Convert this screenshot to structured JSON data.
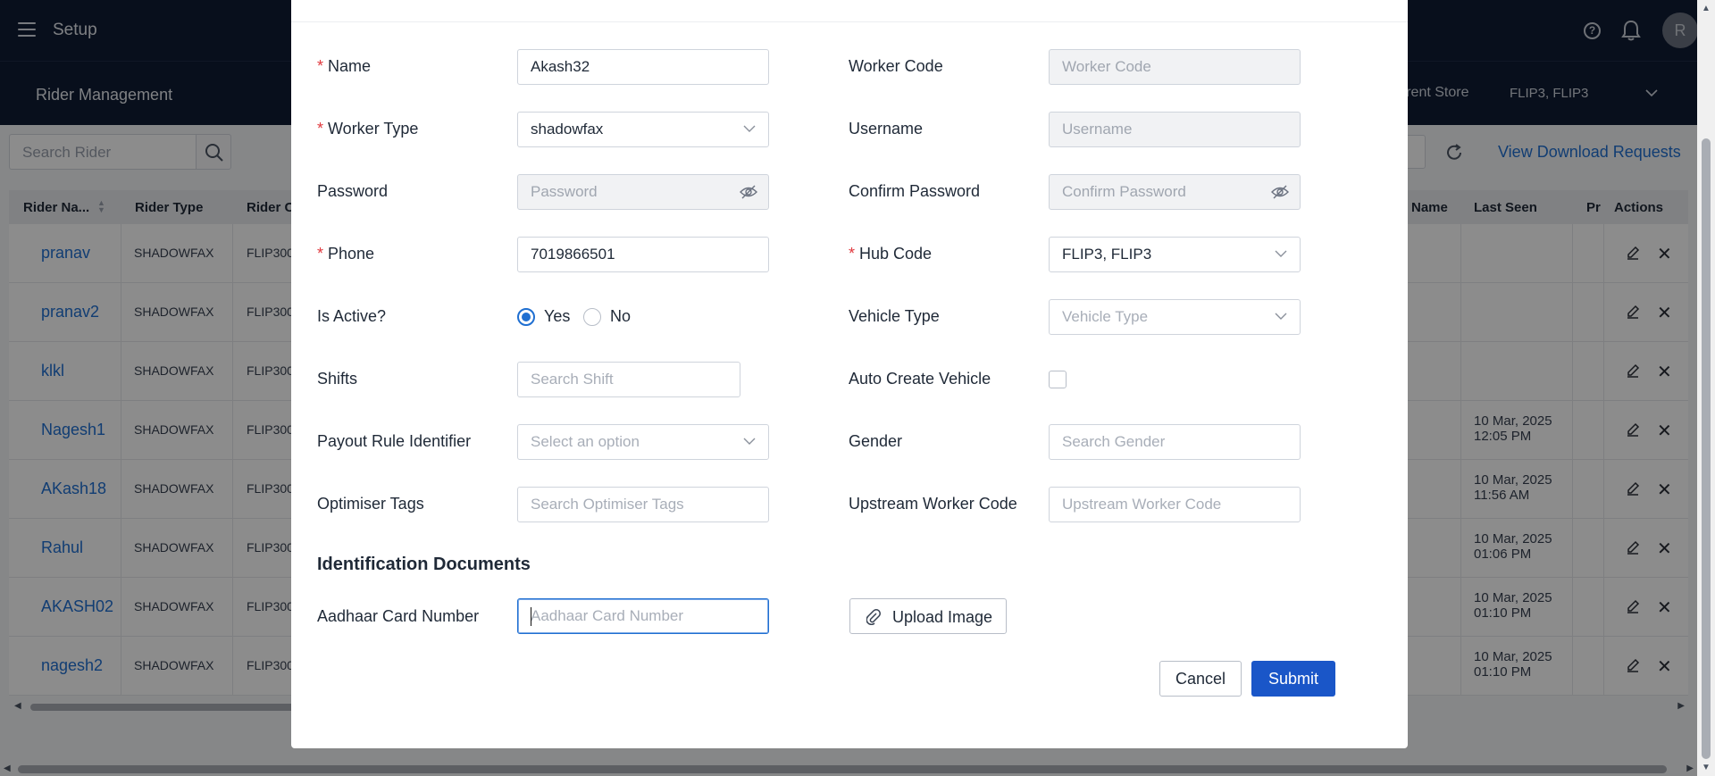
{
  "topbar": {
    "title": "Setup",
    "avatar_initial": "R"
  },
  "subbar": {
    "title": "Rider Management",
    "store_label": "urrent Store",
    "store_value": "FLIP3, FLIP3"
  },
  "toolbar": {
    "search_placeholder": "Search Rider",
    "download_link": "View Download Requests"
  },
  "table": {
    "headers": {
      "name": "Rider Na...",
      "type": "Rider Type",
      "code": "Rider C",
      "hub_name": "Name",
      "last_seen": "Last Seen",
      "pr": "Pr",
      "actions": "Actions"
    },
    "rows": [
      {
        "name": "pranav",
        "type": "SHADOWFAX",
        "code": "FLIP300",
        "seen_date": "",
        "seen_time": ""
      },
      {
        "name": "pranav2",
        "type": "SHADOWFAX",
        "code": "FLIP300",
        "seen_date": "",
        "seen_time": ""
      },
      {
        "name": "klkl",
        "type": "SHADOWFAX",
        "code": "FLIP300",
        "seen_date": "",
        "seen_time": ""
      },
      {
        "name": "Nagesh1",
        "type": "SHADOWFAX",
        "code": "FLIP300",
        "seen_date": "10 Mar, 2025",
        "seen_time": "12:05 PM"
      },
      {
        "name": "AKash18",
        "type": "SHADOWFAX",
        "code": "FLIP300",
        "seen_date": "10 Mar, 2025",
        "seen_time": "11:56 AM"
      },
      {
        "name": "Rahul",
        "type": "SHADOWFAX",
        "code": "FLIP300",
        "seen_date": "10 Mar, 2025",
        "seen_time": "01:06 PM"
      },
      {
        "name": "AKASH02",
        "type": "SHADOWFAX",
        "code": "FLIP300",
        "seen_date": "10 Mar, 2025",
        "seen_time": "01:10 PM"
      },
      {
        "name": "nagesh2",
        "type": "SHADOWFAX",
        "code": "FLIP300",
        "seen_date": "10 Mar, 2025",
        "seen_time": "01:10 PM"
      }
    ]
  },
  "form": {
    "name": {
      "label": "Name",
      "value": "Akash32"
    },
    "worker_code": {
      "label": "Worker Code",
      "placeholder": "Worker Code"
    },
    "worker_type": {
      "label": "Worker Type",
      "value": "shadowfax"
    },
    "username": {
      "label": "Username",
      "placeholder": "Username"
    },
    "password": {
      "label": "Password",
      "placeholder": "Password"
    },
    "confirm_password": {
      "label": "Confirm Password",
      "placeholder": "Confirm Password"
    },
    "phone": {
      "label": "Phone",
      "value": "7019866501"
    },
    "hub_code": {
      "label": "Hub Code",
      "value": "FLIP3, FLIP3"
    },
    "is_active": {
      "label": "Is Active?",
      "yes": "Yes",
      "no": "No"
    },
    "vehicle_type": {
      "label": "Vehicle Type",
      "placeholder": "Vehicle Type"
    },
    "shifts": {
      "label": "Shifts",
      "placeholder": "Search Shift"
    },
    "auto_create_vehicle": {
      "label": "Auto Create Vehicle"
    },
    "payout_rule": {
      "label": "Payout Rule Identifier",
      "placeholder": "Select an option"
    },
    "gender": {
      "label": "Gender",
      "placeholder": "Search Gender"
    },
    "optimiser_tags": {
      "label": "Optimiser Tags",
      "placeholder": "Search Optimiser Tags"
    },
    "upstream_worker_code": {
      "label": "Upstream Worker Code",
      "placeholder": "Upstream Worker Code"
    },
    "section_title": "Identification Documents",
    "aadhaar": {
      "label": "Aadhaar Card Number",
      "placeholder": "Aadhaar Card Number"
    },
    "upload_label": "Upload Image",
    "cancel_label": "Cancel",
    "submit_label": "Submit"
  },
  "colors": {
    "primary": "#1a56c8",
    "link": "#1f6fd1",
    "header_bg": "#0f1c33",
    "required": "#e0393e"
  }
}
